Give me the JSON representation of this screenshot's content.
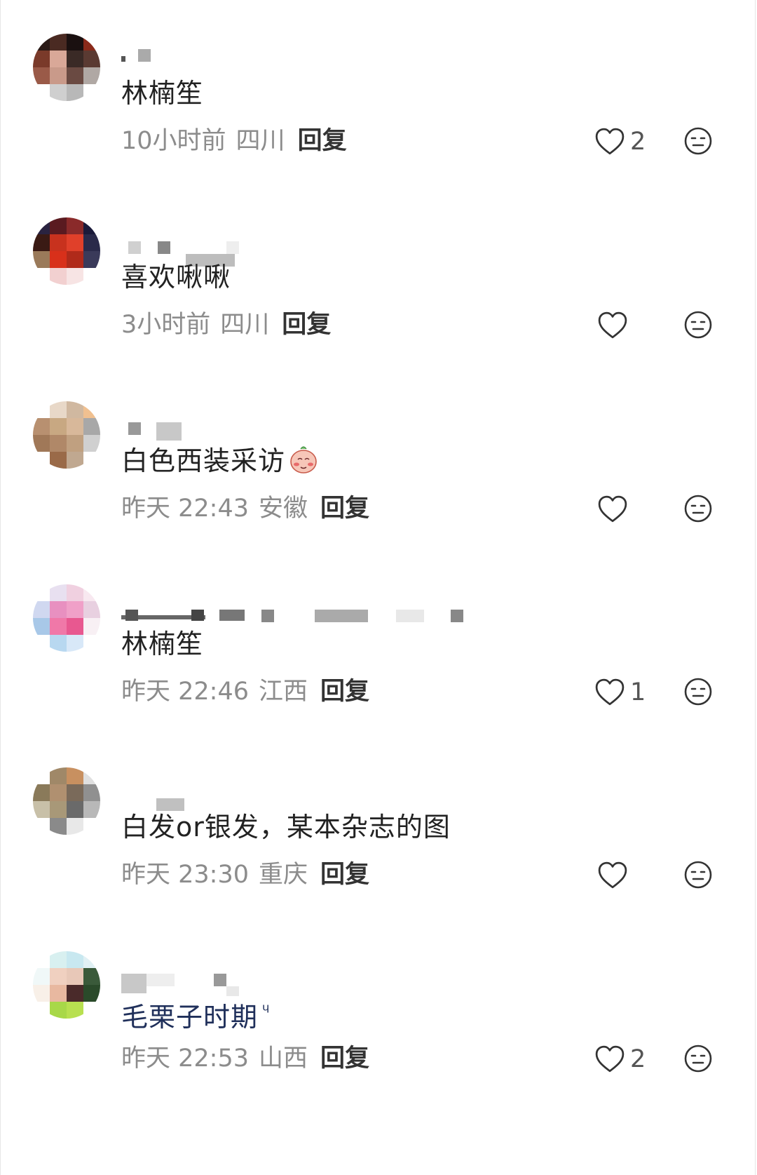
{
  "comments": [
    {
      "content": "林楠笙",
      "time": "10小时前",
      "region": "四川",
      "reply": "回复",
      "likes": "2"
    },
    {
      "content": "喜欢啾啾",
      "time": "3小时前",
      "region": "四川",
      "reply": "回复",
      "likes": ""
    },
    {
      "content": "白色西装采访",
      "time": "昨天 22:43",
      "region": "安徽",
      "reply": "回复",
      "likes": "",
      "sticker": "blushing-peach-sticker"
    },
    {
      "content": "林楠笙",
      "time": "昨天 22:46",
      "region": "江西",
      "reply": "回复",
      "likes": "1"
    },
    {
      "content": "白发or银发，某本杂志的图",
      "time": "昨天 23:30",
      "region": "重庆",
      "reply": "回复",
      "likes": ""
    },
    {
      "content": "毛栗子时期",
      "time": "昨天 22:53",
      "region": "山西",
      "reply": "回复",
      "likes": "2",
      "trailing_mark": "ᶣ"
    }
  ],
  "icons": {
    "like": "heart-outline-icon",
    "reaction": "neutral-face-icon"
  },
  "colors": {
    "text": "#222222",
    "meta": "#8c8c8c",
    "reply": "#333333",
    "icon": "#333333"
  }
}
